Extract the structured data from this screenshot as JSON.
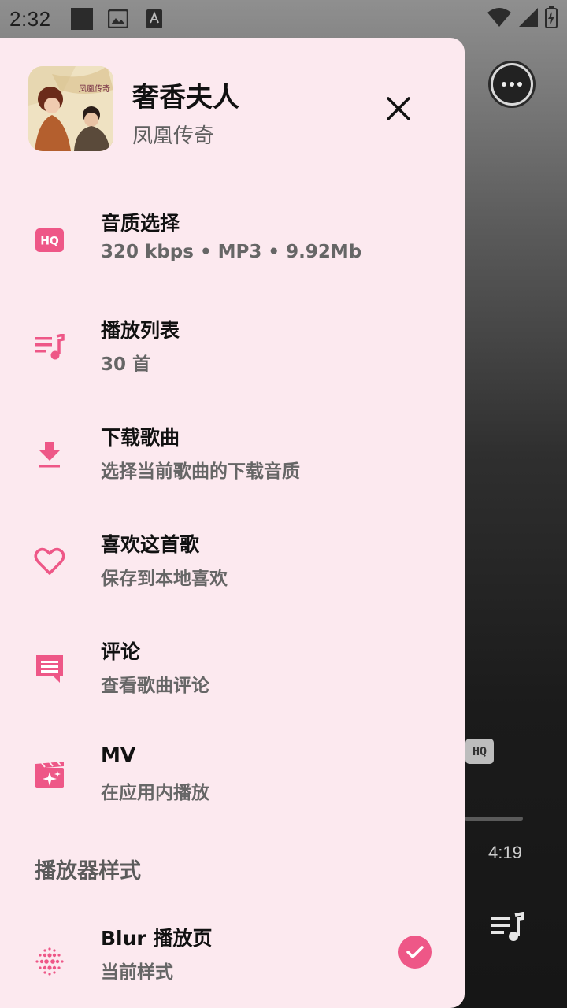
{
  "status_bar": {
    "time": "2:32",
    "icons": [
      "square-notification-icon",
      "image-icon",
      "font-icon",
      "wifi-icon",
      "signal-icon",
      "battery-charging-icon"
    ]
  },
  "colors": {
    "accent": "#ee5787",
    "drawer_bg": "#fce9ef",
    "text_primary": "#111111",
    "text_secondary": "#666666"
  },
  "song": {
    "title": "奢香夫人",
    "album": "凤凰传奇"
  },
  "menu": [
    {
      "icon": "hq-icon",
      "title": "音质选择",
      "subtitle": "320 kbps  •  MP3  •  9.92Mb"
    },
    {
      "icon": "playlist-icon",
      "title": "播放列表",
      "subtitle": "30 首"
    },
    {
      "icon": "download-icon",
      "title": "下载歌曲",
      "subtitle": "选择当前歌曲的下载音质"
    },
    {
      "icon": "heart-icon",
      "title": "喜欢这首歌",
      "subtitle": "保存到本地喜欢"
    },
    {
      "icon": "comment-icon",
      "title": "评论",
      "subtitle": "查看歌曲评论"
    },
    {
      "icon": "mv-icon",
      "title": "MV",
      "subtitle": "在应用内播放"
    }
  ],
  "player_style": {
    "section_title": "播放器样式",
    "option": {
      "icon": "blur-dots-icon",
      "title": "Blur 播放页",
      "subtitle": "当前样式",
      "selected": true
    }
  },
  "background_player": {
    "quality_badge": "HQ",
    "duration": "4:19"
  }
}
